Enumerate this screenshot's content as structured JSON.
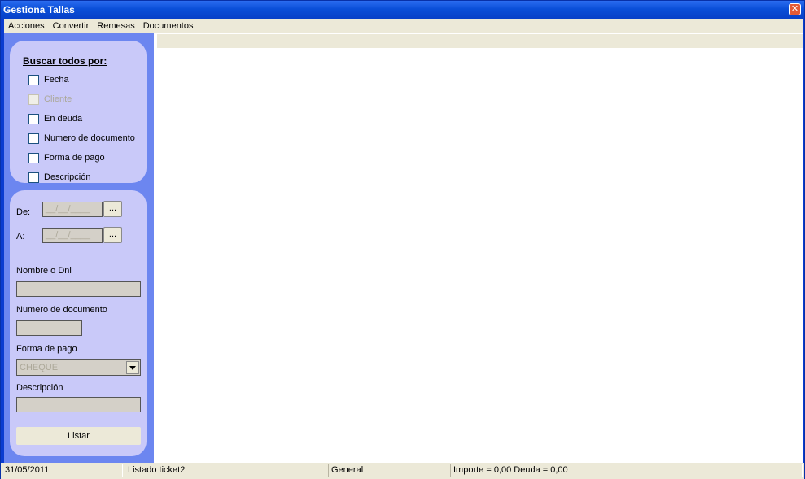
{
  "window": {
    "title": "Gestiona Tallas",
    "close_glyph": "✕"
  },
  "menu": [
    "Acciones",
    "Convertir",
    "Remesas",
    "Documentos"
  ],
  "search_all": {
    "title": "Buscar todos por:",
    "options": [
      {
        "label": "Fecha",
        "checked": false,
        "enabled": true
      },
      {
        "label": "Cliente",
        "checked": false,
        "enabled": false
      },
      {
        "label": "En deuda",
        "checked": false,
        "enabled": true
      },
      {
        "label": "Numero de documento",
        "checked": false,
        "enabled": true
      },
      {
        "label": "Forma de pago",
        "checked": false,
        "enabled": true
      },
      {
        "label": "Descripción",
        "checked": false,
        "enabled": true
      }
    ]
  },
  "filters": {
    "from_label": "De:",
    "from_value": "__/__/____",
    "to_label": "A:",
    "to_value": "__/__/____",
    "picker_label": "...",
    "name_label": "Nombre o Dni",
    "name_value": "",
    "docnum_label": "Numero de documento",
    "docnum_value": "",
    "payment_label": "Forma de pago",
    "payment_value": "CHEQUE",
    "desc_label": "Descripción",
    "desc_value": "",
    "list_button": "Listar"
  },
  "status": {
    "date": "31/05/2011",
    "listing": "Listado ticket2",
    "mode": "General",
    "totals": "Importe = 0,00 Deuda = 0,00"
  }
}
